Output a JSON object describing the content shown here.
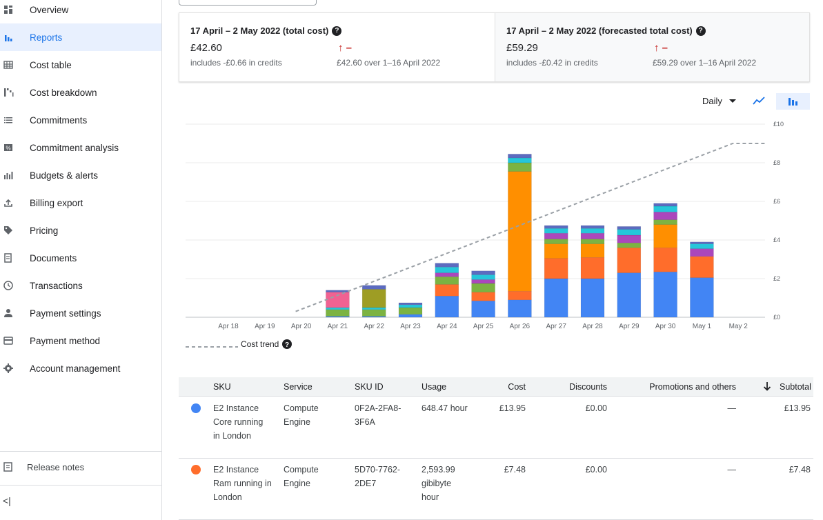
{
  "sidebar": {
    "items": [
      {
        "label": "Overview",
        "icon": "grid-dashboard-icon",
        "active": false
      },
      {
        "label": "Reports",
        "icon": "bar-chart-icon",
        "active": true
      },
      {
        "label": "Cost table",
        "icon": "table-icon",
        "active": false
      },
      {
        "label": "Cost breakdown",
        "icon": "waterfall-chart-icon",
        "active": false
      },
      {
        "label": "Commitments",
        "icon": "list-icon",
        "active": false
      },
      {
        "label": "Commitment analysis",
        "icon": "percent-icon",
        "active": false
      },
      {
        "label": "Budgets & alerts",
        "icon": "budget-chart-icon",
        "active": false
      },
      {
        "label": "Billing export",
        "icon": "upload-icon",
        "active": false
      },
      {
        "label": "Pricing",
        "icon": "tag-icon",
        "active": false
      },
      {
        "label": "Documents",
        "icon": "document-icon",
        "active": false
      },
      {
        "label": "Transactions",
        "icon": "clock-icon",
        "active": false
      },
      {
        "label": "Payment settings",
        "icon": "person-icon",
        "active": false
      },
      {
        "label": "Payment method",
        "icon": "credit-card-icon",
        "active": false
      },
      {
        "label": "Account management",
        "icon": "gear-icon",
        "active": false
      }
    ],
    "release_notes": "Release notes",
    "collapse_glyph": "<|"
  },
  "summary": {
    "left": {
      "title": "17 April – 2 May 2022 (total cost)",
      "amount": "£42.60",
      "credits": "includes -£0.66 in credits",
      "trend": "↑ –",
      "compare": "£42.60 over 1–16 April 2022"
    },
    "right": {
      "title": "17 April – 2 May 2022 (forecasted total cost)",
      "amount": "£59.29",
      "credits": "includes -£0.42 in credits",
      "trend": "↑ –",
      "compare": "£59.29 over 1–16 April 2022"
    }
  },
  "controls": {
    "granularity": "Daily"
  },
  "colors": {
    "accent": "#1a73e8",
    "trend_up": "#c5221f"
  },
  "chart_data": {
    "type": "bar",
    "stacked": true,
    "categories": [
      "Apr 18",
      "Apr 19",
      "Apr 20",
      "Apr 21",
      "Apr 22",
      "Apr 23",
      "Apr 24",
      "Apr 25",
      "Apr 26",
      "Apr 27",
      "Apr 28",
      "Apr 29",
      "Apr 30",
      "May 1",
      "May 2"
    ],
    "y_ticks": [
      "£0",
      "£2",
      "£4",
      "£6",
      "£8",
      "£10"
    ],
    "ylim": [
      0,
      10
    ],
    "grid": true,
    "legend": "Cost trend",
    "series": [
      {
        "name": "E2 Instance Core running in London",
        "color": "#4285f4",
        "values": [
          0,
          0,
          0,
          0.05,
          0.05,
          0.15,
          1.1,
          0.85,
          0.9,
          2.0,
          2.0,
          2.3,
          2.35,
          2.05,
          0
        ]
      },
      {
        "name": "E2 Instance Ram running in London",
        "color": "#ff6d2b",
        "values": [
          0,
          0,
          0,
          0.0,
          0.0,
          0.0,
          0.6,
          0.45,
          0.45,
          1.05,
          1.1,
          1.3,
          1.25,
          1.1,
          0
        ]
      },
      {
        "color": "#ff8f00",
        "values": [
          0,
          0,
          0,
          0,
          0,
          0,
          0,
          0,
          6.2,
          0.75,
          0.7,
          0,
          1.2,
          0,
          0
        ]
      },
      {
        "color": "#7cb342",
        "values": [
          0,
          0,
          0,
          0.35,
          0.35,
          0.35,
          0.4,
          0.45,
          0.45,
          0.25,
          0.25,
          0.25,
          0.25,
          0,
          0
        ]
      },
      {
        "color": "#ab47bc",
        "values": [
          0,
          0,
          0,
          0.0,
          0.0,
          0.0,
          0.2,
          0.2,
          0.0,
          0.3,
          0.3,
          0.4,
          0.4,
          0.4,
          0
        ]
      },
      {
        "color": "#26c6da",
        "values": [
          0,
          0,
          0,
          0.1,
          0.1,
          0.15,
          0.3,
          0.25,
          0.25,
          0.25,
          0.25,
          0.3,
          0.3,
          0.25,
          0
        ]
      },
      {
        "color": "#f06292",
        "values": [
          0,
          0,
          0,
          0.8,
          0.0,
          0.0,
          0,
          0,
          0,
          0,
          0,
          0,
          0,
          0,
          0
        ]
      },
      {
        "color": "#9e9d24",
        "values": [
          0,
          0,
          0,
          0.0,
          0.95,
          0.0,
          0,
          0,
          0,
          0,
          0,
          0,
          0,
          0,
          0
        ]
      },
      {
        "color": "#5c6bc0",
        "values": [
          0,
          0,
          0,
          0.1,
          0.2,
          0.1,
          0.2,
          0.2,
          0.2,
          0.15,
          0.15,
          0.15,
          0.15,
          0.1,
          0
        ]
      }
    ],
    "trend": {
      "x_start": "Apr 20",
      "x_end": "May 2",
      "values": [
        0.3,
        9.0
      ]
    }
  },
  "table": {
    "headers": [
      "SKU",
      "Service",
      "SKU ID",
      "Usage",
      "Cost",
      "Discounts",
      "Promotions and others",
      "Subtotal"
    ],
    "rows": [
      {
        "color": "#4285f4",
        "sku": "E2 Instance Core running in London",
        "service": "Compute Engine",
        "sku_id": "0F2A-2FA8-3F6A",
        "usage": "648.47 hour",
        "cost": "£13.95",
        "discounts": "£0.00",
        "promotions": "—",
        "subtotal": "£13.95"
      },
      {
        "color": "#ff6d2b",
        "sku": "E2 Instance Ram running in London",
        "service": "Compute Engine",
        "sku_id": "5D70-7762-2DE7",
        "usage": "2,593.99 gibibyte hour",
        "cost": "£7.48",
        "discounts": "£0.00",
        "promotions": "—",
        "subtotal": "£7.48"
      }
    ]
  }
}
